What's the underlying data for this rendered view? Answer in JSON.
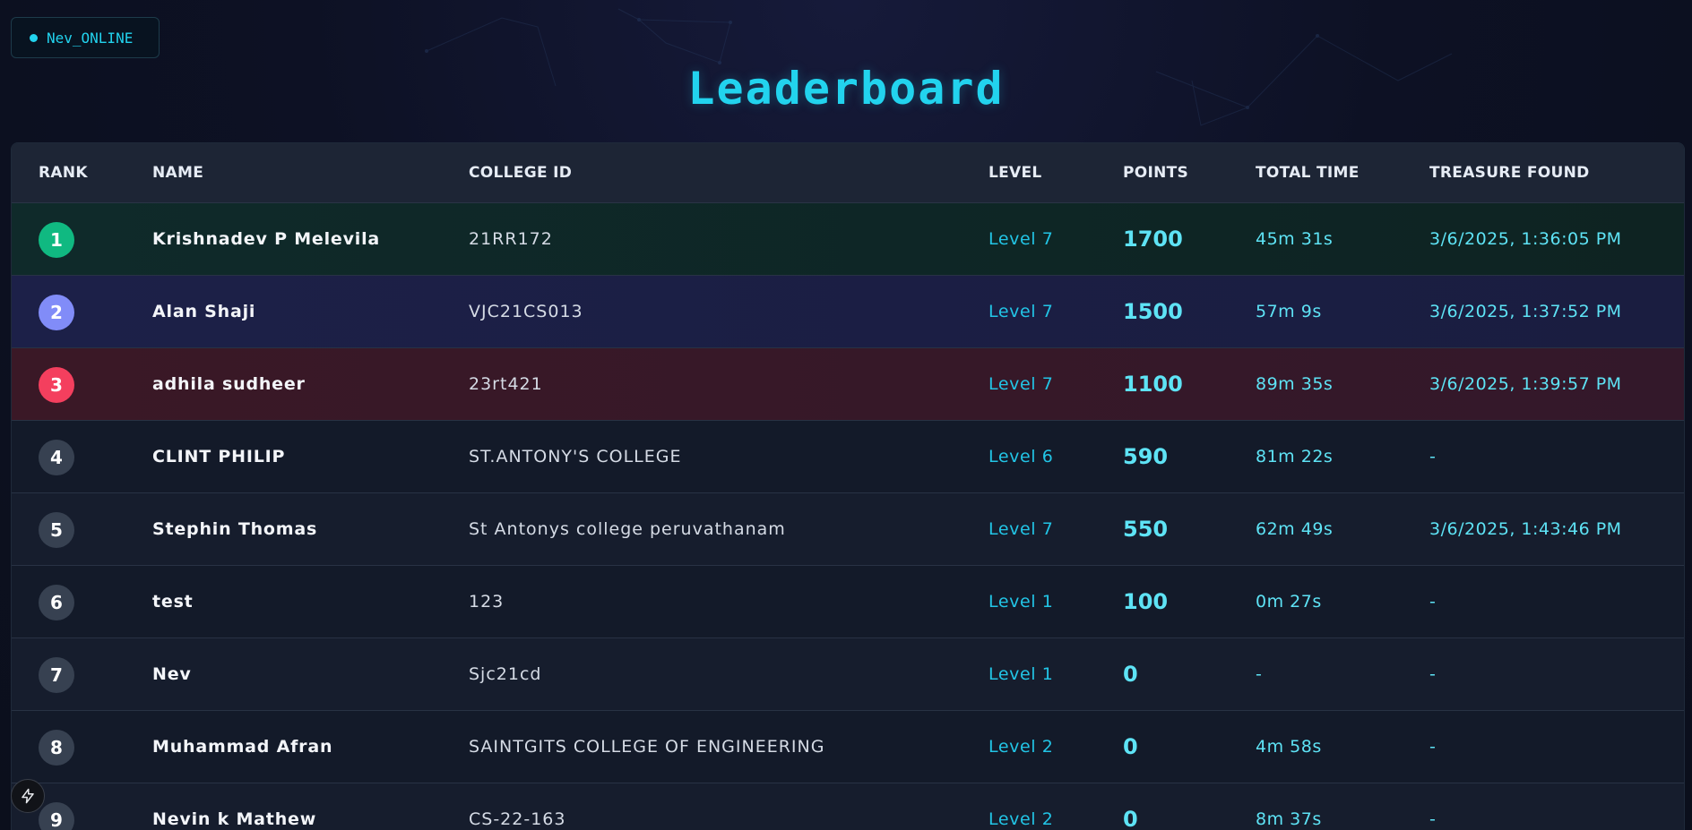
{
  "status": {
    "label": "Nev_ONLINE"
  },
  "title": "Leaderboard",
  "colors": {
    "accent": "#22d3ee",
    "rank1": "#10b981",
    "rank2": "#818cf8",
    "rank3": "#f43f5e",
    "rank_other": "#374151"
  },
  "columns": [
    "RANK",
    "NAME",
    "COLLEGE ID",
    "LEVEL",
    "POINTS",
    "TOTAL TIME",
    "TREASURE FOUND"
  ],
  "rows": [
    {
      "rank": "1",
      "name": "Krishnadev P Melevila",
      "college_id": "21RR172",
      "level": "Level 7",
      "points": "1700",
      "total_time": "45m 31s",
      "treasure_found": "3/6/2025, 1:36:05 PM"
    },
    {
      "rank": "2",
      "name": "Alan Shaji",
      "college_id": "VJC21CS013",
      "level": "Level 7",
      "points": "1500",
      "total_time": "57m 9s",
      "treasure_found": "3/6/2025, 1:37:52 PM"
    },
    {
      "rank": "3",
      "name": "adhila sudheer",
      "college_id": "23rt421",
      "level": "Level 7",
      "points": "1100",
      "total_time": "89m 35s",
      "treasure_found": "3/6/2025, 1:39:57 PM"
    },
    {
      "rank": "4",
      "name": "CLINT PHILIP",
      "college_id": "ST.ANTONY'S COLLEGE",
      "level": "Level 6",
      "points": "590",
      "total_time": "81m 22s",
      "treasure_found": "-"
    },
    {
      "rank": "5",
      "name": "Stephin Thomas",
      "college_id": "St Antonys college peruvathanam",
      "level": "Level 7",
      "points": "550",
      "total_time": "62m 49s",
      "treasure_found": "3/6/2025, 1:43:46 PM"
    },
    {
      "rank": "6",
      "name": "test",
      "college_id": "123",
      "level": "Level 1",
      "points": "100",
      "total_time": "0m 27s",
      "treasure_found": "-"
    },
    {
      "rank": "7",
      "name": "Nev",
      "college_id": "Sjc21cd",
      "level": "Level 1",
      "points": "0",
      "total_time": "-",
      "treasure_found": "-"
    },
    {
      "rank": "8",
      "name": "Muhammad Afran",
      "college_id": "SAINTGITS COLLEGE OF ENGINEERING",
      "level": "Level 2",
      "points": "0",
      "total_time": "4m 58s",
      "treasure_found": "-"
    },
    {
      "rank": "9",
      "name": "Nevin k Mathew",
      "college_id": "CS-22-163",
      "level": "Level 2",
      "points": "0",
      "total_time": "8m 37s",
      "treasure_found": "-"
    }
  ],
  "icons": {
    "dev_tools": "bolt-icon"
  }
}
